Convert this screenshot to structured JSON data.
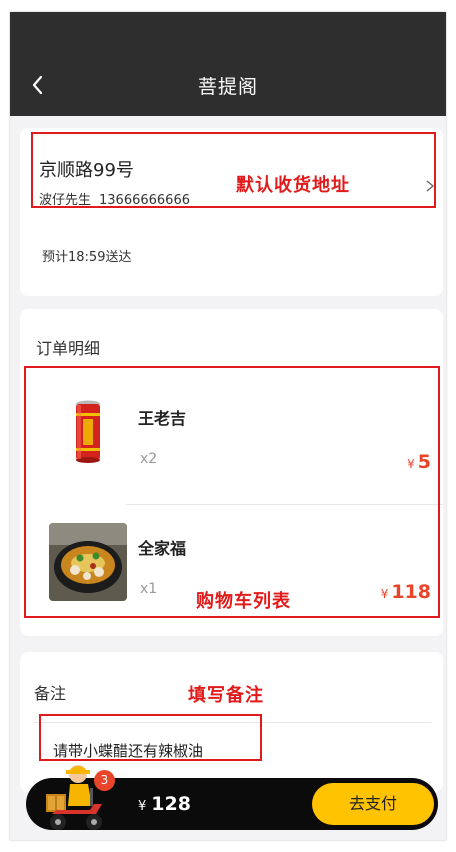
{
  "header": {
    "title": "菩提阁"
  },
  "address": {
    "street": "京顺路99号",
    "contact_name": "波仔先生",
    "phone": "13666666666",
    "eta": "预计18:59送达"
  },
  "order": {
    "title": "订单明细",
    "items": [
      {
        "name": "王老吉",
        "qty": "x2",
        "currency": "¥",
        "price": "5"
      },
      {
        "name": "全家福",
        "qty": "x1",
        "currency": "¥",
        "price": "118"
      }
    ]
  },
  "remark": {
    "title": "备注",
    "value": "请带小蝶醋还有辣椒油"
  },
  "annotations": {
    "address": "默认收货地址",
    "cart_list": "购物车列表",
    "remark": "填写备注"
  },
  "cart": {
    "badge_count": "3",
    "currency": "¥",
    "total": "128",
    "pay_label": "去支付"
  },
  "colors": {
    "header_bg": "#2e2e2e",
    "accent_price": "#e8452b",
    "pay_button": "#ffc300",
    "annotation": "#e11b1b"
  }
}
